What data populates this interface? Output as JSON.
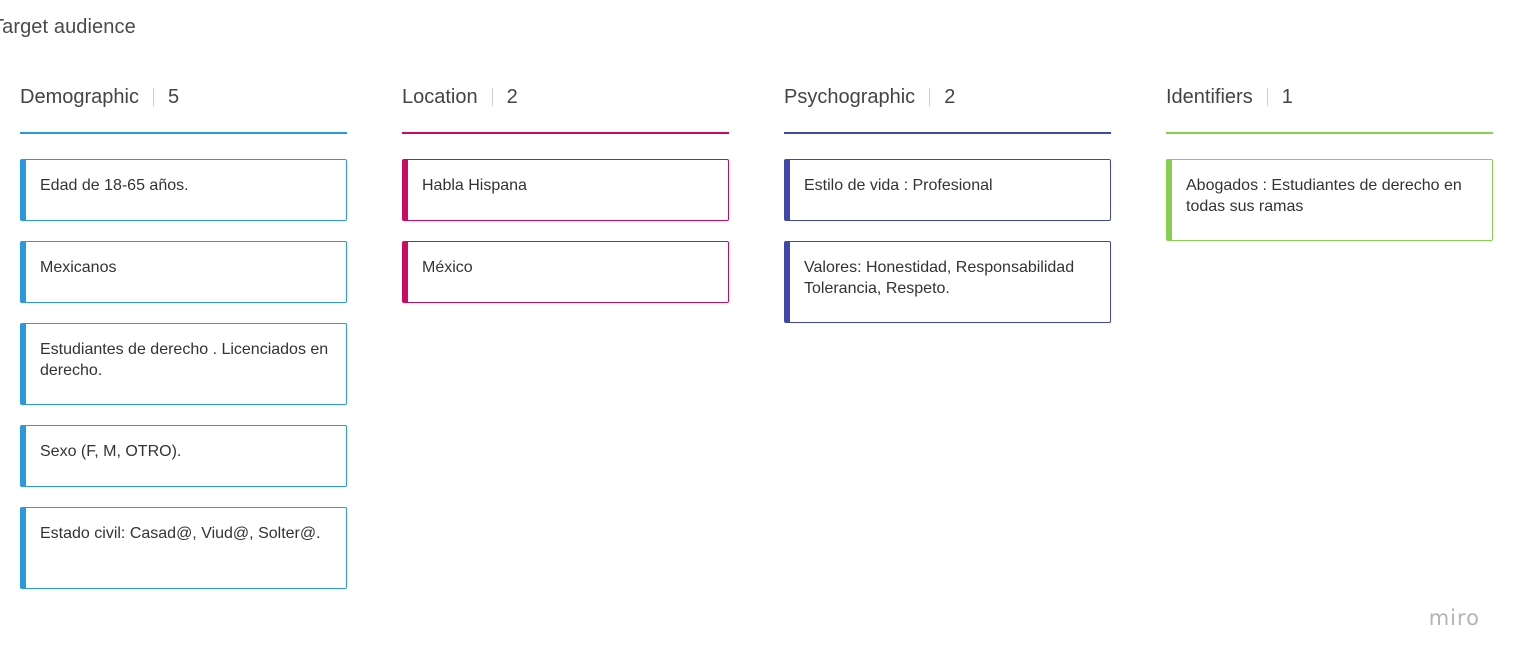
{
  "board": {
    "title": "Target audience"
  },
  "columns": [
    {
      "title": "Demographic",
      "count": "5",
      "color": "#2a9ae0",
      "cards": [
        "Edad de 18-65 años.",
        "Mexicanos",
        "Estudiantes de derecho . Licenciados en derecho.",
        "Sexo  (F, M, OTRO).",
        "Estado civil: Casad@, Viud@, Solter@."
      ]
    },
    {
      "title": "Location",
      "count": "2",
      "color": "#cc0a5f",
      "cards": [
        "Habla Hispana",
        "México"
      ]
    },
    {
      "title": "Psychographic",
      "count": "2",
      "color": "#3f48a8",
      "cards": [
        "Estilo de vida : Profesional",
        "Valores: Honestidad, Responsabilidad Tolerancia, Respeto."
      ]
    },
    {
      "title": "Identifiers",
      "count": "1",
      "color": "#86cf4f",
      "cards": [
        "Abogados : Estudiantes de derecho en todas sus ramas"
      ]
    }
  ],
  "branding": {
    "logo_text": "miro"
  }
}
